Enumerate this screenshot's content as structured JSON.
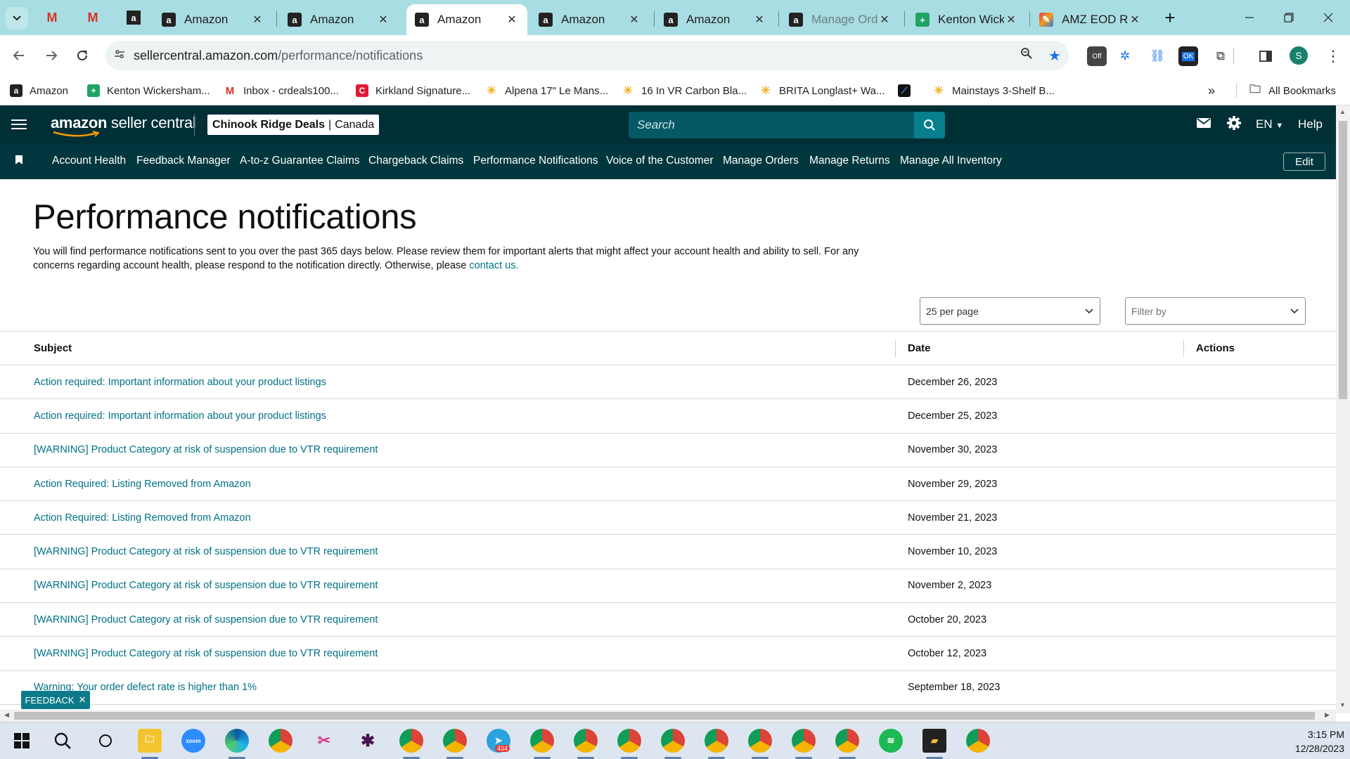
{
  "browser": {
    "tabs": [
      {
        "label": "Amazon",
        "favicon": "amazon-icon",
        "active": false
      },
      {
        "label": "Amazon",
        "favicon": "amazon-icon",
        "active": false
      },
      {
        "label": "Amazon",
        "favicon": "amazon-icon",
        "active": true
      },
      {
        "label": "Amazon",
        "favicon": "amazon-icon",
        "active": false
      },
      {
        "label": "Amazon",
        "favicon": "amazon-icon",
        "active": false
      },
      {
        "label": "Manage Orde",
        "favicon": "amazon-icon",
        "active": false
      },
      {
        "label": "Kenton Wick",
        "favicon": "sheets-icon",
        "active": false
      },
      {
        "label": "AMZ EOD Re",
        "favicon": "pen-icon",
        "active": false
      }
    ],
    "url_host": "sellercentral.amazon.com",
    "url_path": "/performance/notifications",
    "bookmarks": [
      "Amazon",
      "Kenton Wickersham...",
      "Inbox - crdeals100...",
      "Kirkland Signature...",
      "Alpena 17\" Le Mans...",
      "16 In VR Carbon Bla...",
      "BRITA Longlast+ Wa...",
      "",
      "Mainstays 3-Shelf B..."
    ],
    "all_bookmarks": "All Bookmarks",
    "extension_badges": {
      "off": "Off",
      "ok": "OK"
    },
    "profile_initial": "S"
  },
  "header": {
    "logo_bold": "amazon",
    "logo_rest": " seller central",
    "store_name": "Chinook Ridge Deals",
    "store_region": "Canada",
    "search_placeholder": "Search",
    "language": "EN",
    "help": "Help"
  },
  "nav": {
    "items": [
      "Account Health",
      "Feedback Manager",
      "A-to-z Guarantee Claims",
      "Chargeback Claims",
      "Performance Notifications",
      "Voice of the Customer",
      "Manage Orders",
      "Manage Returns",
      "Manage All Inventory"
    ],
    "edit": "Edit"
  },
  "page": {
    "title": "Performance notifications",
    "intro": "You will find performance notifications sent to you over the past 365 days below. Please review them for important alerts that might affect your account health and ability to sell. For any concerns regarding account health, please respond to the notification directly. Otherwise, please ",
    "contact_link": "contact us.",
    "per_page": "25 per page",
    "filter_placeholder": "Filter by",
    "columns": {
      "subject": "Subject",
      "date": "Date",
      "actions": "Actions"
    },
    "rows": [
      {
        "subject": "Action required: Important information about your product listings",
        "date": "December 26, 2023"
      },
      {
        "subject": "Action required: Important information about your product listings",
        "date": "December 25, 2023"
      },
      {
        "subject": "[WARNING] Product Category at risk of suspension due to VTR requirement",
        "date": "November 30, 2023"
      },
      {
        "subject": "Action Required: Listing Removed from Amazon",
        "date": "November 29, 2023"
      },
      {
        "subject": "Action Required: Listing Removed from Amazon",
        "date": "November 21, 2023"
      },
      {
        "subject": "[WARNING] Product Category at risk of suspension due to VTR requirement",
        "date": "November 10, 2023"
      },
      {
        "subject": "[WARNING] Product Category at risk of suspension due to VTR requirement",
        "date": "November 2, 2023"
      },
      {
        "subject": "[WARNING] Product Category at risk of suspension due to VTR requirement",
        "date": "October 20, 2023"
      },
      {
        "subject": "[WARNING] Product Category at risk of suspension due to VTR requirement",
        "date": "October 12, 2023"
      },
      {
        "subject": "Warning: Your order defect rate is higher than 1%",
        "date": "September 18, 2023"
      }
    ],
    "feedback": "FEEDBACK"
  },
  "taskbar": {
    "time": "3:15 PM",
    "date": "12/28/2023",
    "telegram_badge": "434",
    "zoom_label": "zoom"
  },
  "colors": {
    "header_bg": "#002f36",
    "nav_bg": "#00373e",
    "link": "#007185",
    "tabstrip": "#a8dde3"
  }
}
